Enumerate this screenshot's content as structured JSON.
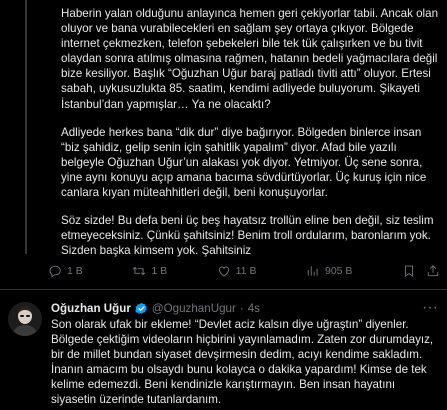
{
  "tweet1": {
    "paragraphs": [
      "Haberin yalan olduğunu anlayınca hemen geri çekiyorlar tabii. Ancak olan oluyor ve bana vurabilecekleri en sağlam şey ortaya çıkıyor. Bölgede internet çekmezken, telefon şebekeleri bile tek tük çalışırken ve bu tivit olaydan sonra atılmış olmasına rağmen, hatanın bedeli yağmacılara değil bize kesiliyor. Başlık “Oğuzhan Uğur baraj patladı tiviti attı” oluyor. Ertesi sabah, uykusuzlukta 85. saatim, kendimi adliyede buluyorum. Şikayeti İstanbul’dan yapmışlar… Ya ne olacaktı?",
      "Adliyede herkes bana “dik dur” diye bağırıyor. Bölgeden binlerce insan “biz şahidiz, gelip senin için şahitlik yapalım” diyor. Afad bile yazılı belgeyle Oğuzhan Uğur’un alakası yok diyor. Yetmiyor. Üç sene sonra, yine aynı konuyu açıp amana bacıma sövdürtüyorlar. Üç kuruş için nice canlara kıyan müteahhitleri değil, beni konuşuyorlar.",
      "Söz sizde! Bu defa beni üç beş hayatsız trollün eline ben değil, siz teslim etmeyeceksiniz. Çünkü şahitsiniz! Benim troll ordularım, baronlarım yok. Sizden başka kimsem yok. Şahitsiniz"
    ],
    "actions": {
      "replies": "1 B",
      "retweets": "1 B",
      "likes": "11 B",
      "views": "905 B"
    }
  },
  "tweet2": {
    "author_name": "Oğuzhan Uğur",
    "author_handle": "@OguzhanUgur",
    "separator": "·",
    "time": "4s",
    "more": "···",
    "text": "Son olarak ufak bir ekleme! “Devlet aciz kalsın diye uğraştın” diyenler. Bölgede çektiğim videoların hiçbirini yayınlamadım. Zaten zor durumdayız, bir de millet bundan siyaset devşirmesin dedim, acıyı kendime sakladım. İnanın amacım bu olsaydı bunu kolayca o dakika yapardım! Kimse de tek kelime edemezdi. Beni kendinizle karıştırmayın. Ben insan hayatını siyasetin üzerinde tutanlardanım."
  },
  "colors": {
    "background": "#000000",
    "text": "#e7e9ea",
    "muted": "#71767b",
    "verified": "#1d9bf0",
    "divider": "#2f3336"
  },
  "icons": {
    "reply": "reply-icon",
    "retweet": "retweet-icon",
    "like": "heart-icon",
    "views": "views-icon",
    "bookmark": "bookmark-icon",
    "share": "share-icon",
    "verified": "verified-badge-icon"
  }
}
